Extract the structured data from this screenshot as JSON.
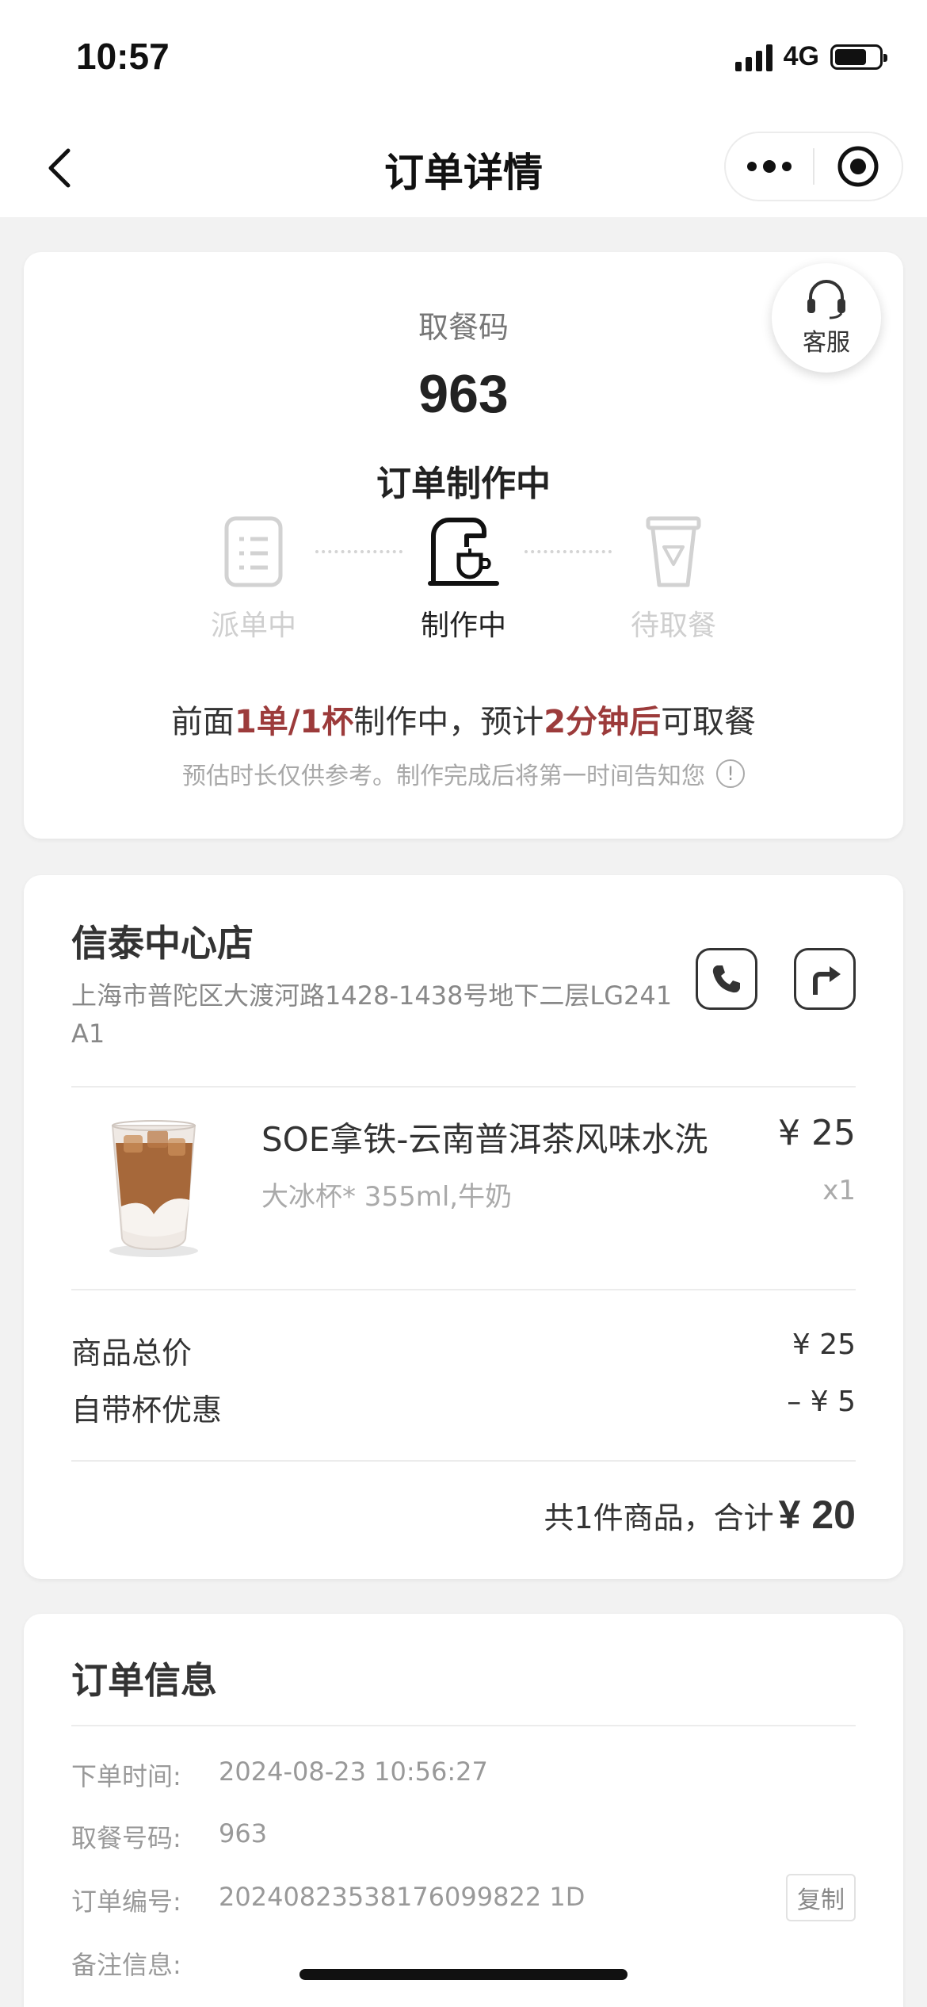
{
  "status_bar": {
    "time": "10:57",
    "network": "4G"
  },
  "nav": {
    "title": "订单详情"
  },
  "pickup": {
    "service_label": "客服",
    "code_label": "取餐码",
    "code": "963",
    "status": "订单制作中",
    "steps": [
      {
        "label": "派单中",
        "state": "inactive",
        "icon": "clipboard-icon"
      },
      {
        "label": "制作中",
        "state": "active",
        "icon": "coffee-machine-icon"
      },
      {
        "label": "待取餐",
        "state": "inactive",
        "icon": "cup-icon"
      }
    ],
    "queue_text": {
      "p1": "前面",
      "h1": "1单/1杯",
      "p2": "制作中，预计",
      "h2": "2分钟后",
      "p3": "可取餐"
    },
    "note": "预估时长仅供参考。制作完成后将第一时间告知您",
    "note_icon_glyph": "!",
    "accent_color": "#9c3b3b"
  },
  "store": {
    "name": "信泰中心店",
    "address": "上海市普陀区大渡河路1428-1438号地下二层LG241 A1",
    "product": {
      "name": "SOE拿铁-云南普洱茶风味水洗",
      "price": "¥ 25",
      "spec": "大冰杯* 355ml,牛奶",
      "qty": "x1"
    },
    "fees": [
      {
        "label": "商品总价",
        "value": "¥ 25"
      },
      {
        "label": "自带杯优惠",
        "value": "– ¥ 5"
      }
    ],
    "total_prefix": "共1件商品，合计",
    "total_amount": "¥ 20"
  },
  "order_info": {
    "title": "订单信息",
    "rows": [
      {
        "key": "下单时间:",
        "value": "2024-08-23 10:56:27"
      },
      {
        "key": "取餐号码:",
        "value": "963"
      },
      {
        "key": "订单编号:",
        "value": "20240823538176099822 1D"
      },
      {
        "key": "备注信息:",
        "value": ""
      }
    ],
    "copy_label": "复制"
  }
}
